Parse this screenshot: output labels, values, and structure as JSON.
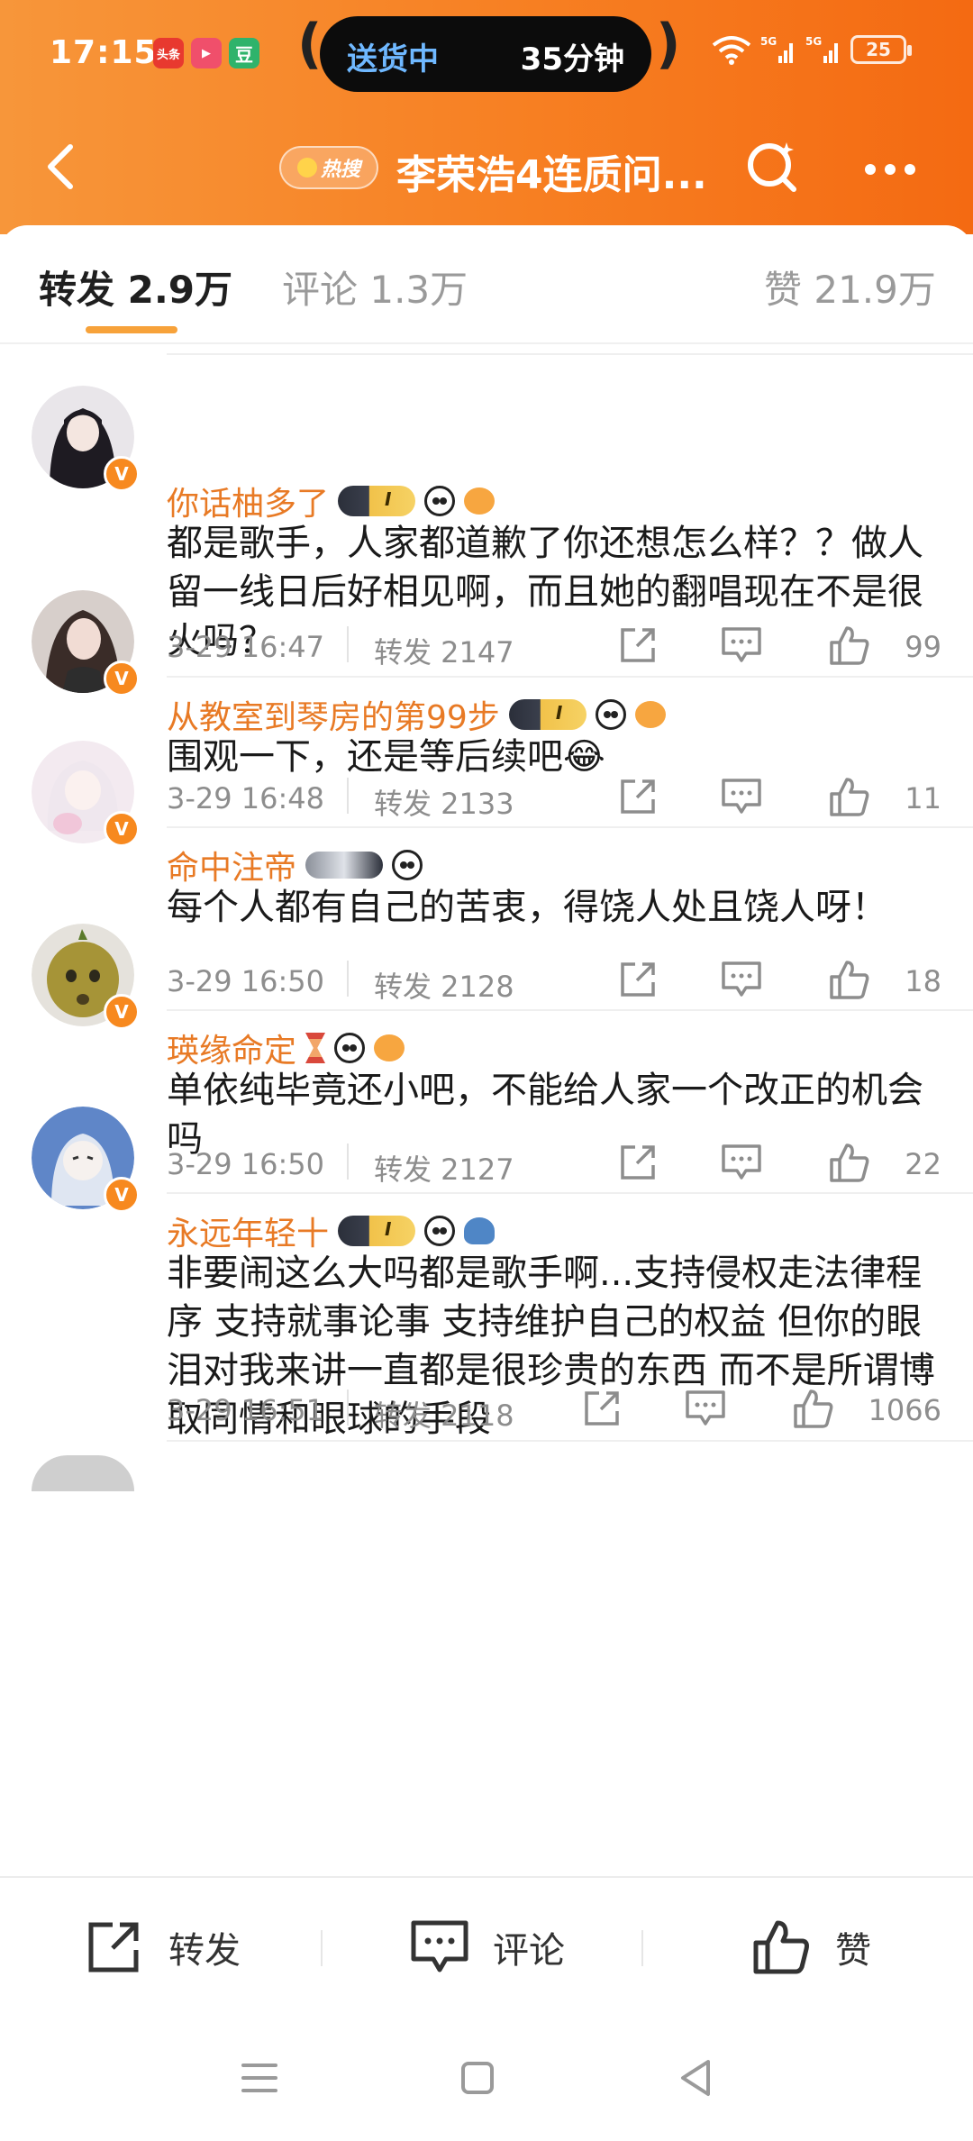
{
  "status_bar": {
    "time": "17:15",
    "app_icons": [
      {
        "name": "toutiao-icon",
        "label": "头条",
        "color": "#e8392f"
      },
      {
        "name": "video-icon",
        "label": "▶",
        "color": "#f04f6b"
      },
      {
        "name": "douban-icon",
        "label": "豆",
        "color": "#2fb36b"
      }
    ],
    "delivery_pill": {
      "status": "送货中",
      "eta": "35分钟"
    },
    "signal": "5G",
    "battery": "25"
  },
  "nav": {
    "hot_badge": "热搜",
    "title": "李荣浩4连质问..."
  },
  "tabs": [
    {
      "label": "转发 2.9万",
      "active": true
    },
    {
      "label": "评论 1.3万",
      "active": false
    },
    {
      "label": "赞 21.9万",
      "active": false
    }
  ],
  "comments": [
    {
      "username": "你话柚多了",
      "badges": [
        "crown-badge",
        "panda-badge",
        "fish-badge"
      ],
      "avatar_color": "#2c2a33",
      "text": "都是歌手，人家都道歉了你还想怎么样？？做人留一线日后好相见啊，而且她的翻唱现在不是很火吗？",
      "date": "3-29 16:47",
      "repost": "转发 2147",
      "likes": "99"
    },
    {
      "username": "从教室到琴房的第99步",
      "badges": [
        "crown-badge",
        "panda-badge",
        "fish-badge"
      ],
      "avatar_color": "#6b5a55",
      "text": "围观一下，还是等后续吧😂",
      "date": "3-29 16:48",
      "repost": "转发 2133",
      "likes": "11"
    },
    {
      "username": "命中注帝",
      "badges": [
        "bike-badge",
        "panda-badge"
      ],
      "avatar_color": "#e9d6e3",
      "text": "每个人都有自己的苦衷，得饶人处且饶人呀！",
      "date": "3-29 16:50",
      "repost": "转发 2128",
      "likes": "18"
    },
    {
      "username": "瑛缘命定",
      "badges": [
        "hourglass-badge",
        "panda-badge",
        "fish-badge"
      ],
      "avatar_color": "#9a8a3c",
      "text": "单依纯毕竟还小吧，不能给人家一个改正的机会吗",
      "date": "3-29 16:50",
      "repost": "转发 2127",
      "likes": "22"
    },
    {
      "username": "永远年轻十",
      "badges": [
        "crown-badge",
        "panda-badge",
        "shark-badge"
      ],
      "avatar_color": "#5f86c8",
      "text": "非要闹这么大吗都是歌手啊...支持侵权走法律程序 支持就事论事 支持维护自己的权益 但你的眼泪对我来讲一直都是很珍贵的东西 而不是所谓博取同情和眼球的手段",
      "date": "3-29 16:51",
      "repost": "转发 2118",
      "likes": "1066"
    }
  ],
  "action_bar": {
    "repost": "转发",
    "comment": "评论",
    "like": "赞"
  },
  "colors": {
    "header_start": "#f7963a",
    "header_end": "#f46a12",
    "username": "#e87a25",
    "tab_underline": "#f7a23a"
  }
}
